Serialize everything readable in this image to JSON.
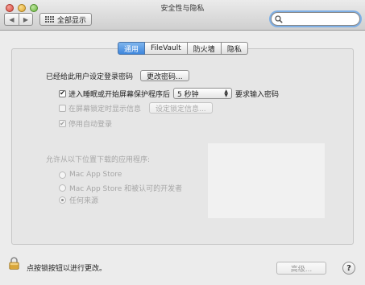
{
  "window": {
    "title": "安全性与隐私"
  },
  "toolbar": {
    "back_glyph": "◀",
    "forward_glyph": "▶",
    "show_all_label": "全部显示",
    "search": {
      "placeholder": "",
      "value": ""
    }
  },
  "tabs": [
    {
      "label": "通用",
      "active": true
    },
    {
      "label": "FileVault",
      "active": false
    },
    {
      "label": "防火墙",
      "active": false
    },
    {
      "label": "隐私",
      "active": false
    }
  ],
  "general": {
    "password_set_text": "已经给此用户设定登录密码",
    "change_password_button": "更改密码...",
    "require_password": {
      "checked": true,
      "label_before": "进入睡眠或开始屏幕保护程序后",
      "delay_selected": "5 秒钟",
      "label_after": "要求输入密码"
    },
    "show_lock_message": {
      "checked": false,
      "enabled": false,
      "label": "在屏幕锁定时显示信息",
      "set_message_button": "设定锁定信息..."
    },
    "disable_auto_login": {
      "checked": true,
      "enabled": false,
      "label": "停用自动登录"
    },
    "allow_apps_from": {
      "heading": "允许从以下位置下载的应用程序:",
      "options": [
        {
          "label": "Mac App Store",
          "selected": false
        },
        {
          "label": "Mac App Store 和被认可的开发者",
          "selected": false
        },
        {
          "label": "任何来源",
          "selected": true
        }
      ]
    }
  },
  "footer": {
    "lock_text": "点按锁按钮以进行更改。",
    "advanced_button": "高级...",
    "help_label": "?"
  },
  "icons": {
    "close": "red-close-icon",
    "minimize": "yellow-minimize-icon",
    "zoom": "green-zoom-icon",
    "grid": "grid-icon",
    "search": "search-icon",
    "lock": "lock-icon"
  }
}
